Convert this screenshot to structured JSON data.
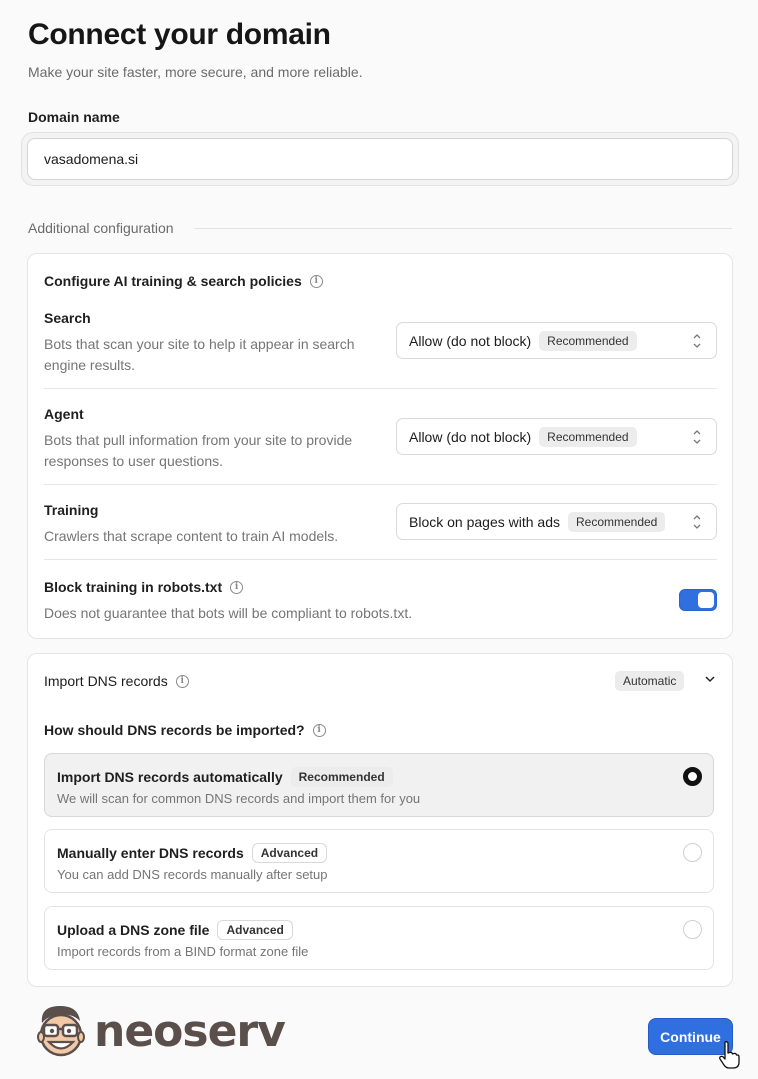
{
  "header": {
    "title": "Connect your domain",
    "subtitle": "Make your site faster, more secure, and more reliable."
  },
  "domain": {
    "label": "Domain name",
    "value": "vasadomena.si"
  },
  "additional_config": {
    "label": "Additional configuration"
  },
  "ai_policies": {
    "title": "Configure AI training & search policies",
    "rows": [
      {
        "name": "Search",
        "description": "Bots that scan your site to help it appear in search engine results.",
        "selected": "Allow (do not block)",
        "badge": "Recommended"
      },
      {
        "name": "Agent",
        "description": "Bots that pull information from your site to provide responses to user questions.",
        "selected": "Allow (do not block)",
        "badge": "Recommended"
      },
      {
        "name": "Training",
        "description": "Crawlers that scrape content to train AI models.",
        "selected": "Block on pages with ads",
        "badge": "Recommended"
      }
    ],
    "robots": {
      "name": "Block training in robots.txt",
      "description": "Does not guarantee that bots will be compliant to robots.txt.",
      "enabled": true
    }
  },
  "dns": {
    "title": "Import DNS records",
    "mode_badge": "Automatic",
    "question": "How should DNS records be imported?",
    "options": [
      {
        "title": "Import DNS records automatically",
        "badge": "Recommended",
        "description": "We will scan for common DNS records and import them for you",
        "selected": true
      },
      {
        "title": "Manually enter DNS records",
        "badge": "Advanced",
        "description": "You can add DNS records manually after setup",
        "selected": false
      },
      {
        "title": "Upload a DNS zone file",
        "badge": "Advanced",
        "description": "Import records from a BIND format zone file",
        "selected": false
      }
    ]
  },
  "footer": {
    "logo_text": "neoserv",
    "continue_label": "Continue"
  },
  "colors": {
    "accent": "#2f6fe0",
    "logo_brown": "#5a4f4a"
  },
  "icons": [
    "info-icon",
    "chevron-updown-icon",
    "chevron-down-icon",
    "mascot-icon",
    "pointer-cursor-icon"
  ]
}
